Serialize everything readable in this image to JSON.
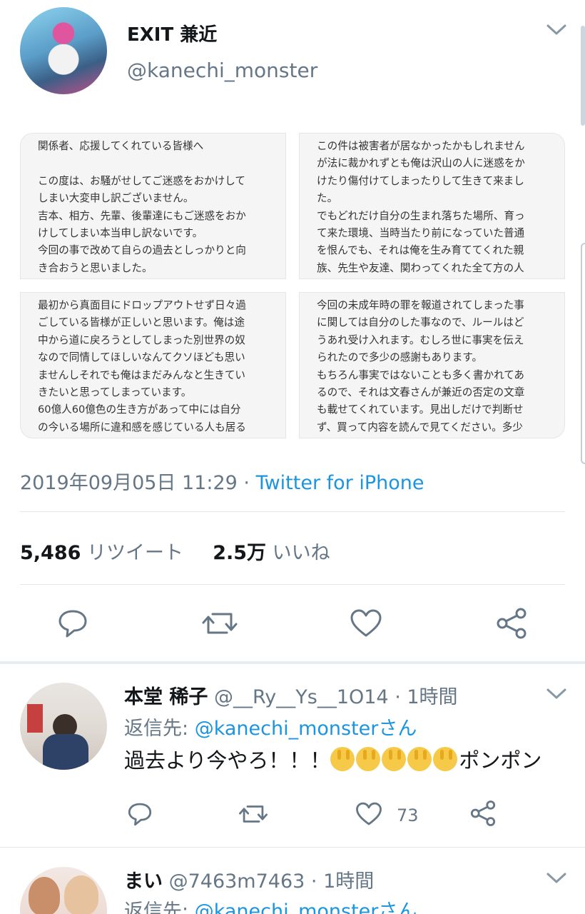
{
  "tweet": {
    "display_name": "EXIT 兼近",
    "handle": "@kanechi_monster",
    "images": [
      {
        "text": "関係者、応援してくれている皆様へ\n\nこの度は、お騒がせしてご迷惑をおかけして\nしまい大変申し訳ございません。\n吉本、相方、先輩、後輩達にもご迷惑をおか\nけしてしまい本当申し訳ないです。\n今回の事で改めて自らの過去としっかりと向\nき合おうと思いました。"
      },
      {
        "text": "この件は被害者が居なかったかもしれません\nが法に裁かれずとも俺は沢山の人に迷惑をか\nけたり傷付けてしまったりして生きて来まし\nた。\nでもどれだけ自分の生まれ落ちた場所、育っ\nて来た環境、当時当たり前になっていた普通\nを恨んでも、それは俺を生み育ててくれた親\n族、先生や友達、関わってくれた全て方の人"
      },
      {
        "text": "最初から真面目にドロップアウトせず日々過\nごしている皆様が正しいと思います。俺は途\n中から道に戻ろうとしてしまった別世界の奴\nなので同情してほしいなんてクソほども思い\nませんしそれでも俺はまだみんなと生きてい\nきたいと思ってしまっています。\n60億人60億色の生き方があって中には自分\nの今いる場所に違和感を感じている人も居る"
      },
      {
        "text": "今回の未成年時の罪を報道されてしまった事\nに関しては自分のした事なので、ルールはど\nうあれ受け入れます。むしろ世に事実を伝え\nられたので多少の感謝もあります。\nもちろん事実ではないことも多く書かれてあ\nるので、それは文春さんが兼近の否定の文章\nも載せてくれています。見出しだけで判断せ\nず、買って内容を読んで見てください。多少"
      }
    ],
    "timestamp": "2019年09月05日 11:29",
    "source_sep": " · ",
    "source": "Twitter for iPhone",
    "retweets_count": "5,486",
    "retweets_label": "リツイート",
    "likes_count": "2.5万",
    "likes_label": "いいね"
  },
  "replies": [
    {
      "name": "本堂 稀子",
      "handle": "@__Ry__Ys__1O14",
      "time": "· 1時間",
      "replying_label": "返信先: ",
      "replying_to": "@kanechi_monsterさん",
      "text_before": "過去より今やろ！！！",
      "emoji_count": 5,
      "text_after": "ポンポン",
      "like_count": "73"
    },
    {
      "name": "まい",
      "handle": "@7463m7463",
      "time": "· 1時間",
      "replying_label": "返信先: ",
      "replying_to": "@kanechi_monsterさん"
    }
  ],
  "icons": {
    "reply": "reply-icon",
    "retweet": "retweet-icon",
    "like": "heart-icon",
    "share": "share-icon",
    "more": "chevron-down-icon"
  },
  "colors": {
    "link": "#1b95e0",
    "secondary": "#657786",
    "primary": "#14171a",
    "divider": "#e1e8ed"
  }
}
